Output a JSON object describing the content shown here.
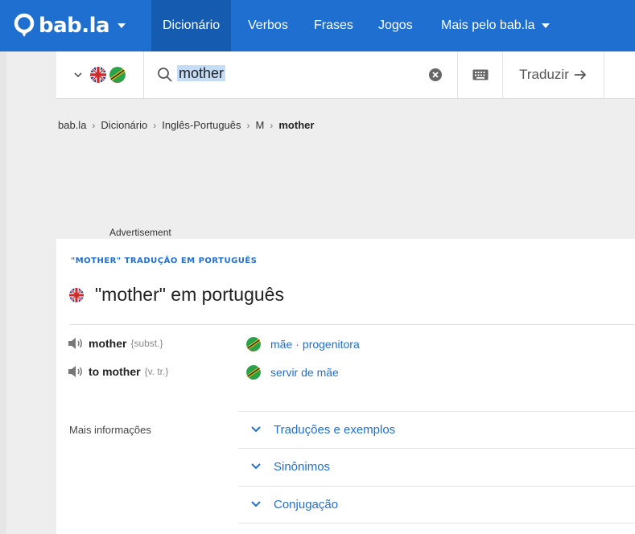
{
  "nav": {
    "logo": "bab.la",
    "items": [
      "Dicionário",
      "Verbos",
      "Frases",
      "Jogos",
      "Mais pelo bab.la"
    ]
  },
  "search": {
    "value": "mother",
    "translate_label": "Traduzir"
  },
  "breadcrumb": [
    "bab.la",
    "Dicionário",
    "Inglês-Português",
    "M",
    "mother"
  ],
  "ad_label": "Advertisement",
  "main": {
    "eyebrow": "\"MOTHER\" TRADUÇÃO EM PORTUGUÊS",
    "title": "\"mother\" em português",
    "entries": [
      {
        "term": "mother",
        "pos": "{subst.}",
        "translations": [
          "mãe",
          "progenitora"
        ]
      },
      {
        "term": "to mother",
        "pos": "{v. tr.}",
        "translations": [
          "servir de mãe"
        ]
      }
    ],
    "more_label": "Mais informações",
    "accordions": [
      "Traduções e exemplos",
      "Sinônimos",
      "Conjugação"
    ]
  },
  "colors": {
    "brand": "#1f6fd0",
    "nav_active": "#155bb0",
    "link": "#1f6fd0"
  }
}
